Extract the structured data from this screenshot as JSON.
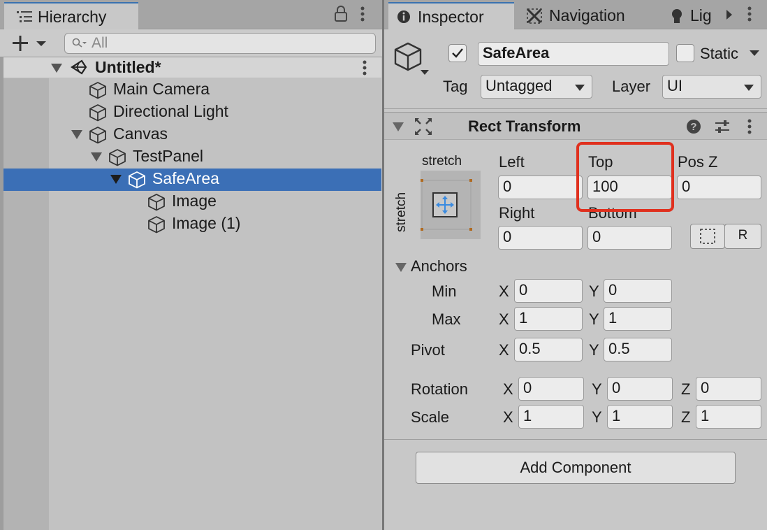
{
  "hierarchy": {
    "tab_label": "Hierarchy",
    "search_placeholder": "All",
    "scene_name": "Untitled*",
    "items": [
      {
        "label": "Main Camera"
      },
      {
        "label": "Directional Light"
      },
      {
        "label": "Canvas"
      },
      {
        "label": "TestPanel"
      },
      {
        "label": "SafeArea"
      },
      {
        "label": "Image"
      },
      {
        "label": "Image (1)"
      }
    ]
  },
  "inspector": {
    "tabs": [
      {
        "label": "Inspector",
        "icon": "info-icon"
      },
      {
        "label": "Navigation",
        "icon": "navmesh-icon"
      },
      {
        "label": "Lig",
        "icon": "lightbulb-icon"
      }
    ],
    "object_name": "SafeArea",
    "active_checked": true,
    "static_label": "Static",
    "tag_label": "Tag",
    "tag_value": "Untagged",
    "layer_label": "Layer",
    "layer_value": "UI",
    "component_title": "Rect Transform",
    "anchor_preset_top": "stretch",
    "anchor_preset_side": "stretch",
    "fields": {
      "left_label": "Left",
      "left_value": "0",
      "top_label": "Top",
      "top_value": "100",
      "posz_label": "Pos Z",
      "posz_value": "0",
      "right_label": "Right",
      "right_value": "0",
      "bottom_label": "Bottom",
      "bottom_value": "0"
    },
    "r_button": "R",
    "anchors_label": "Anchors",
    "anchors_min_label": "Min",
    "anchors_min": {
      "x": "0",
      "y": "0"
    },
    "anchors_max_label": "Max",
    "anchors_max": {
      "x": "1",
      "y": "1"
    },
    "pivot_label": "Pivot",
    "pivot": {
      "x": "0.5",
      "y": "0.5"
    },
    "rotation_label": "Rotation",
    "rotation": {
      "x": "0",
      "y": "0",
      "z": "0"
    },
    "scale_label": "Scale",
    "scale": {
      "x": "1",
      "y": "1",
      "z": "1"
    },
    "axis": {
      "x": "X",
      "y": "Y",
      "z": "Z"
    },
    "add_component": "Add Component"
  },
  "colors": {
    "selection": "#3b6fb6",
    "highlight": "#e0301e",
    "tab_accent": "#3a72b0"
  }
}
